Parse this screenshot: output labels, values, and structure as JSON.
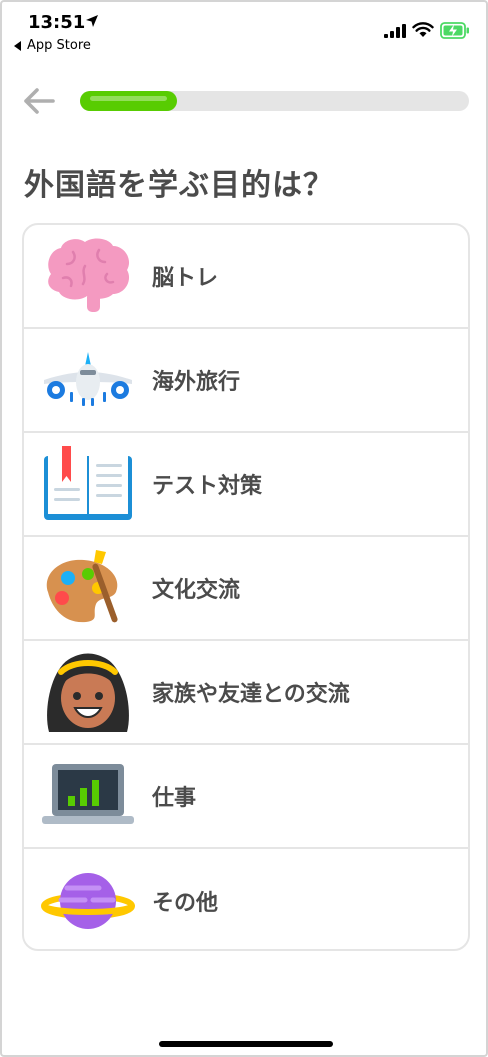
{
  "status_bar": {
    "time": "13:51",
    "back_app": "App Store",
    "battery_color": "#4cd964"
  },
  "header": {
    "progress_percent": 25,
    "progress_color": "#58cc02"
  },
  "title": "外国語を学ぶ目的は？",
  "options": [
    {
      "label": "脳トレ",
      "icon": "brain-icon"
    },
    {
      "label": "海外旅行",
      "icon": "airplane-icon"
    },
    {
      "label": "テスト対策",
      "icon": "book-icon"
    },
    {
      "label": "文化交流",
      "icon": "paint-palette-icon"
    },
    {
      "label": "家族や友達との交流",
      "icon": "person-face-icon"
    },
    {
      "label": "仕事",
      "icon": "laptop-chart-icon"
    },
    {
      "label": "その他",
      "icon": "planet-icon"
    }
  ]
}
